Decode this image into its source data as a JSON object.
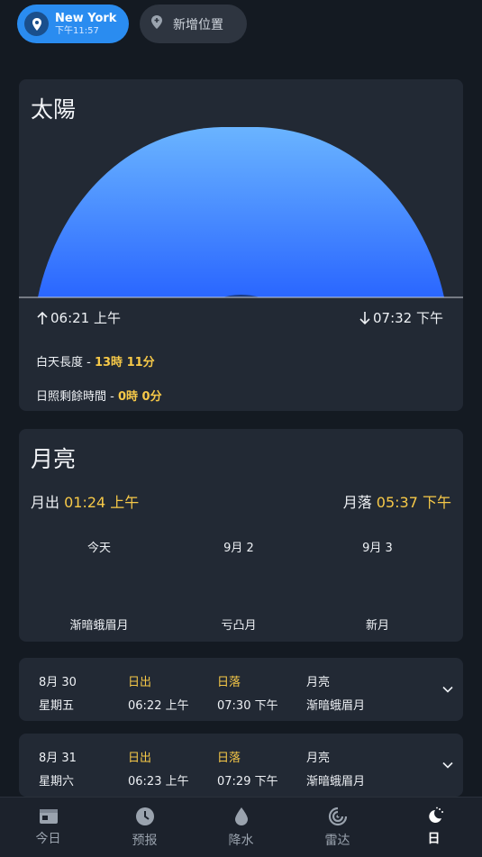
{
  "locations": {
    "active": {
      "city": "New York",
      "time": "下午11:57"
    },
    "add_label": "新增位置"
  },
  "sun": {
    "title": "太陽",
    "sunrise": "06:21 上午",
    "sunset": "07:32 下午",
    "daylight_label": "白天長度 -",
    "daylight_value": "13時 11分",
    "remaining_label": "日照剩餘時間 -",
    "remaining_value": "0時 0分",
    "colors": {
      "arc_top": "#6ab4ff",
      "arc_bottom": "#2a66ff"
    }
  },
  "moon": {
    "title": "月亮",
    "moonrise_label": "月出",
    "moonrise": "01:24 上午",
    "moonset_label": "月落",
    "moonset": "05:37 下午",
    "phases": [
      {
        "date": "今天",
        "phase": "渐暗蛾眉月"
      },
      {
        "date": "9月 2",
        "phase": "亏凸月"
      },
      {
        "date": "9月 3",
        "phase": "新月"
      }
    ]
  },
  "days": [
    {
      "date": "8月 30",
      "weekday": "星期五",
      "sunrise_label": "日出",
      "sunrise": "06:22 上午",
      "sunset_label": "日落",
      "sunset": "07:30 下午",
      "moon_label": "月亮",
      "moon_phase": "渐暗蛾眉月"
    },
    {
      "date": "8月 31",
      "weekday": "星期六",
      "sunrise_label": "日出",
      "sunrise": "06:23 上午",
      "sunset_label": "日落",
      "sunset": "07:29 下午",
      "moon_label": "月亮",
      "moon_phase": "渐暗蛾眉月"
    }
  ],
  "nav": [
    {
      "label": "今日",
      "icon": "calendar-icon"
    },
    {
      "label": "预报",
      "icon": "clock-icon"
    },
    {
      "label": "降水",
      "icon": "drop-icon"
    },
    {
      "label": "雷达",
      "icon": "radar-icon"
    },
    {
      "label": "日",
      "icon": "moon-sun-icon",
      "active": true
    }
  ]
}
